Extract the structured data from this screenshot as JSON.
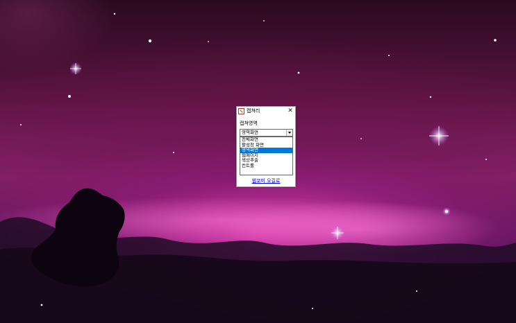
{
  "dialog": {
    "title": "캡쳐리",
    "section_label": "캡쳐영역",
    "combo_value": "영역화면",
    "options": [
      "전체화면",
      "활성창 화면",
      "영역화면",
      "웹페이지",
      "색상추출",
      "컨트롤"
    ],
    "selected_index": 2,
    "link_text": "웹쿄미 오길로"
  },
  "icons": {
    "app": "capture-app-icon",
    "close": "close-icon",
    "dropdown": "chevron-down-icon"
  },
  "colors": {
    "selection": "#0078d7",
    "link": "#0000ee",
    "app_icon": "#c8322c"
  }
}
